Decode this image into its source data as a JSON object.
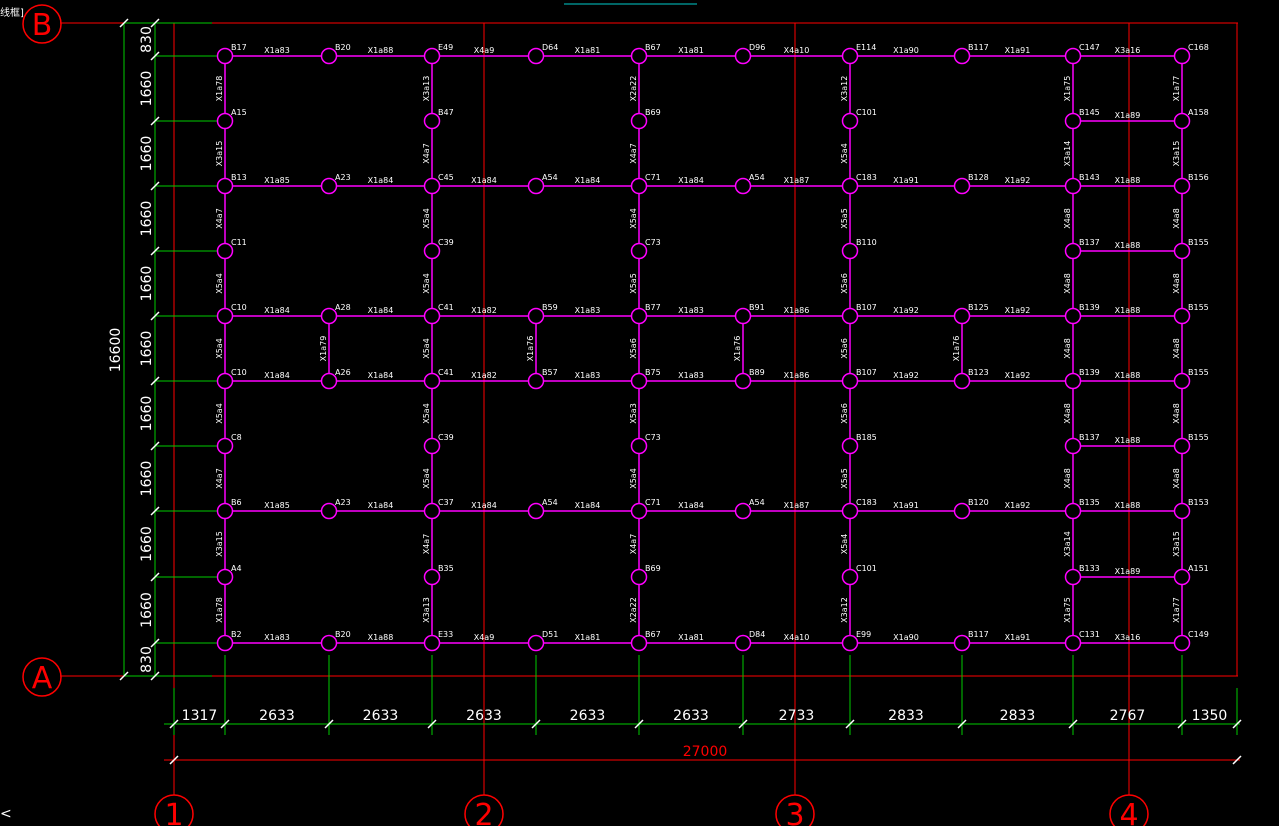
{
  "header": {
    "corner_label": "线框]",
    "cursor_glyph": "<"
  },
  "colors": {
    "background": "#000000",
    "grid": "#ff0000",
    "dim_green": "#00cc00",
    "dim_text": "#ffffff",
    "beam": "#ff00ff",
    "label": "#ffffff",
    "axis_bubble": "#ff0000",
    "top_marker": "#00cccc"
  },
  "axes": {
    "rows": [
      {
        "label": "B"
      },
      {
        "label": "A"
      }
    ],
    "columns": [
      {
        "label": "1"
      },
      {
        "label": "2"
      },
      {
        "label": "3"
      },
      {
        "label": "4"
      }
    ]
  },
  "dimensions": {
    "horizontal": [
      "1317",
      "2633",
      "2633",
      "2633",
      "2633",
      "2633",
      "2733",
      "2833",
      "2833",
      "2767",
      "1350"
    ],
    "horizontal_total": "27000",
    "vertical": [
      "830",
      "1660",
      "1660",
      "1660",
      "1660",
      "1660",
      "1660",
      "1660",
      "1660",
      "1660",
      "830"
    ],
    "vertical_total": "16600"
  },
  "nodes": [
    [
      "B17",
      "B20",
      "E49",
      "D64",
      "B67",
      "D96",
      "E114",
      "B117",
      "C147",
      "C168"
    ],
    [
      "A15",
      "",
      "B47",
      "",
      "B69",
      "",
      "C101",
      "",
      "B145",
      "A158"
    ],
    [
      "B13",
      "A23",
      "C45",
      "A54",
      "C71",
      "A54",
      "C183",
      "B128",
      "B143",
      "B156"
    ],
    [
      "C11",
      "",
      "C39",
      "",
      "C73",
      "",
      "B110",
      "",
      "B137",
      "B155"
    ],
    [
      "C10",
      "A28",
      "C41",
      "B59",
      "B77",
      "B91",
      "B107",
      "B125",
      "B139",
      "B155"
    ],
    [
      "C10",
      "A26",
      "C41",
      "B57",
      "B75",
      "B89",
      "B107",
      "B123",
      "B139",
      "B155"
    ],
    [
      "C8",
      "",
      "C39",
      "",
      "C73",
      "",
      "B185",
      "",
      "B137",
      "B155"
    ],
    [
      "B6",
      "A23",
      "C37",
      "A54",
      "C71",
      "A54",
      "C183",
      "B120",
      "B135",
      "B153"
    ],
    [
      "A4",
      "",
      "B35",
      "",
      "B69",
      "",
      "C101",
      "",
      "B133",
      "A151"
    ],
    [
      "B2",
      "B20",
      "E33",
      "D51",
      "B67",
      "D84",
      "E99",
      "B117",
      "C131",
      "C149"
    ]
  ],
  "h_beams": [
    [
      "X1a83",
      "X1a88",
      "X4a9",
      "X1a81",
      "X1a81",
      "X4a10",
      "X1a90",
      "X1a91",
      "X3a16"
    ],
    [
      "",
      "",
      "",
      "",
      "",
      "",
      "",
      "",
      "X1a89"
    ],
    [
      "X1a85",
      "X1a84",
      "X1a84",
      "X1a84",
      "X1a84",
      "X1a87",
      "X1a91",
      "X1a92",
      "X1a88"
    ],
    [
      "",
      "",
      "",
      "",
      "",
      "",
      "",
      "",
      "X1a88"
    ],
    [
      "X1a84",
      "X1a84",
      "X1a82",
      "X1a83",
      "X1a83",
      "X1a86",
      "X1a92",
      "X1a92",
      "X1a88"
    ],
    [
      "X1a84",
      "X1a84",
      "X1a82",
      "X1a83",
      "X1a83",
      "X1a86",
      "X1a92",
      "X1a92",
      "X1a88"
    ],
    [
      "",
      "",
      "",
      "",
      "",
      "",
      "",
      "",
      "X1a88"
    ],
    [
      "X1a85",
      "X1a84",
      "X1a84",
      "X1a84",
      "X1a84",
      "X1a87",
      "X1a91",
      "X1a92",
      "X1a88"
    ],
    [
      "",
      "",
      "",
      "",
      "",
      "",
      "",
      "",
      "X1a89"
    ],
    [
      "X1a83",
      "X1a88",
      "X4a9",
      "X1a81",
      "X1a81",
      "X4a10",
      "X1a90",
      "X1a91",
      "X3a16"
    ]
  ],
  "v_beams": [
    [
      "X1a78",
      "",
      "X3a13",
      "",
      "X2a22",
      "",
      "X3a12",
      "",
      "X1a75",
      "X1a77"
    ],
    [
      "X3a15",
      "",
      "X4a7",
      "",
      "X4a7",
      "",
      "X5a4",
      "",
      "X3a14",
      "X3a15"
    ],
    [
      "X4a7",
      "",
      "X5a4",
      "",
      "X5a4",
      "",
      "X5a5",
      "",
      "X4a8",
      "X4a8"
    ],
    [
      "X5a4",
      "",
      "X5a4",
      "",
      "X5a5",
      "",
      "X5a6",
      "",
      "X4a8",
      "X4a8"
    ],
    [
      "X5a4",
      "X1a79",
      "X5a4",
      "X1a76",
      "X5a6",
      "X1a76",
      "X5a6",
      "X1a76",
      "X4a8",
      "X4a8"
    ],
    [
      "X5a4",
      "",
      "X5a4",
      "",
      "X5a3",
      "",
      "X5a6",
      "",
      "X4a8",
      "X4a8"
    ],
    [
      "X4a7",
      "",
      "X5a4",
      "",
      "X5a4",
      "",
      "X5a5",
      "",
      "X4a8",
      "X4a8"
    ],
    [
      "X3a15",
      "",
      "X4a7",
      "",
      "X4a7",
      "",
      "X5a4",
      "",
      "X3a14",
      "X3a15"
    ],
    [
      "X1a78",
      "",
      "X3a13",
      "",
      "X2a22",
      "",
      "X3a12",
      "",
      "X1a75",
      "X1a77"
    ]
  ]
}
